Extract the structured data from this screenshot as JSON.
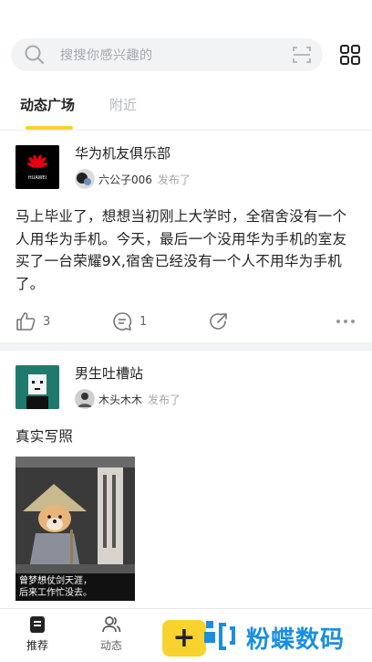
{
  "search": {
    "placeholder": "搜搜你感兴趣的"
  },
  "tabs": [
    {
      "label": "动态广场",
      "active": true
    },
    {
      "label": "附近",
      "active": false
    }
  ],
  "posts": [
    {
      "group_name": "华为机友俱乐部",
      "group_logo_text": "HUAWEI",
      "user_name": "六公子006",
      "posted_label": "发布了",
      "text": "马上毕业了，想想当初刚上大学时，全宿舍没有一个人用华为手机。今天，最后一个没用华为手机的室友买了一台荣耀9X,宿舍已经没有一个人不用华为手机了。",
      "likes": "3",
      "comments": "1"
    },
    {
      "group_name": "男生吐槽站",
      "user_name": "木头木木",
      "posted_label": "发布了",
      "text": "真实写照",
      "image_caption_line1": "曾梦想仗剑天涯，",
      "image_caption_line2": "后来工作忙没去。"
    }
  ],
  "bottom_nav": [
    {
      "label": "推荐",
      "active": true
    },
    {
      "label": "动态",
      "active": false
    }
  ],
  "add_button": "+",
  "watermark": "粉蝶数码",
  "colors": {
    "accent": "#f8d22f",
    "watermark": "#1a8fe0",
    "huawei_red": "#e60012"
  }
}
